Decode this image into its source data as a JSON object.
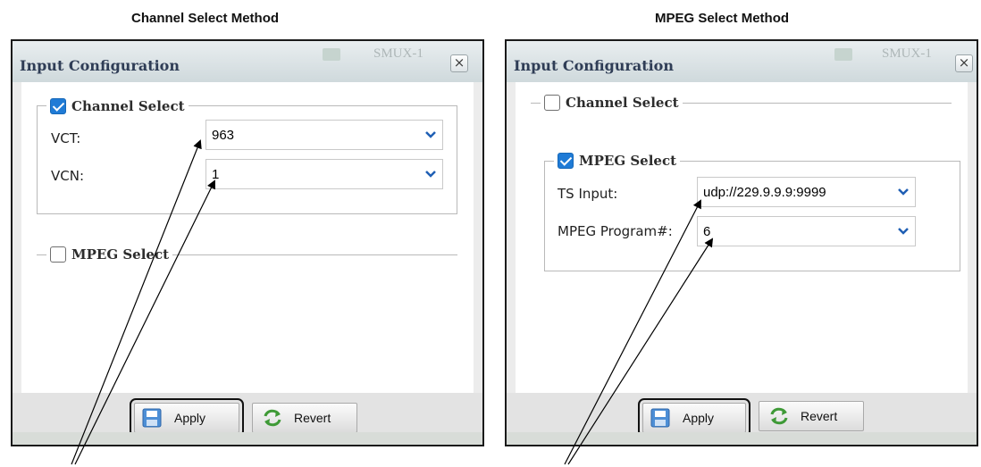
{
  "captions": {
    "left": "Channel Select Method",
    "right": "MPEG Select Method"
  },
  "left_panel": {
    "title": "Input Configuration",
    "background_label": "SMUX-1",
    "close_label": "×",
    "channel_select": {
      "checked": true,
      "label": "Channel Select",
      "vct_label": "VCT:",
      "vct_value": "963",
      "vcn_label": "VCN:",
      "vcn_value": "1"
    },
    "mpeg_select": {
      "checked": false,
      "label": "MPEG Select"
    },
    "apply_label": "Apply",
    "revert_label": "Revert"
  },
  "right_panel": {
    "title": "Input Configuration",
    "background_label": "SMUX-1",
    "close_label": "×",
    "channel_select": {
      "checked": false,
      "label": "Channel Select"
    },
    "mpeg_select": {
      "checked": true,
      "label": "MPEG Select",
      "ts_input_label": "TS Input:",
      "ts_input_value": "udp://229.9.9.9:9999",
      "program_label": "MPEG Program#:",
      "program_value": "6"
    },
    "apply_label": "Apply",
    "revert_label": "Revert"
  },
  "colors": {
    "checkbox_checked": "#1f7bd6",
    "dropdown_arrow": "#1f5fb4",
    "panel_title": "#2f3d56"
  }
}
